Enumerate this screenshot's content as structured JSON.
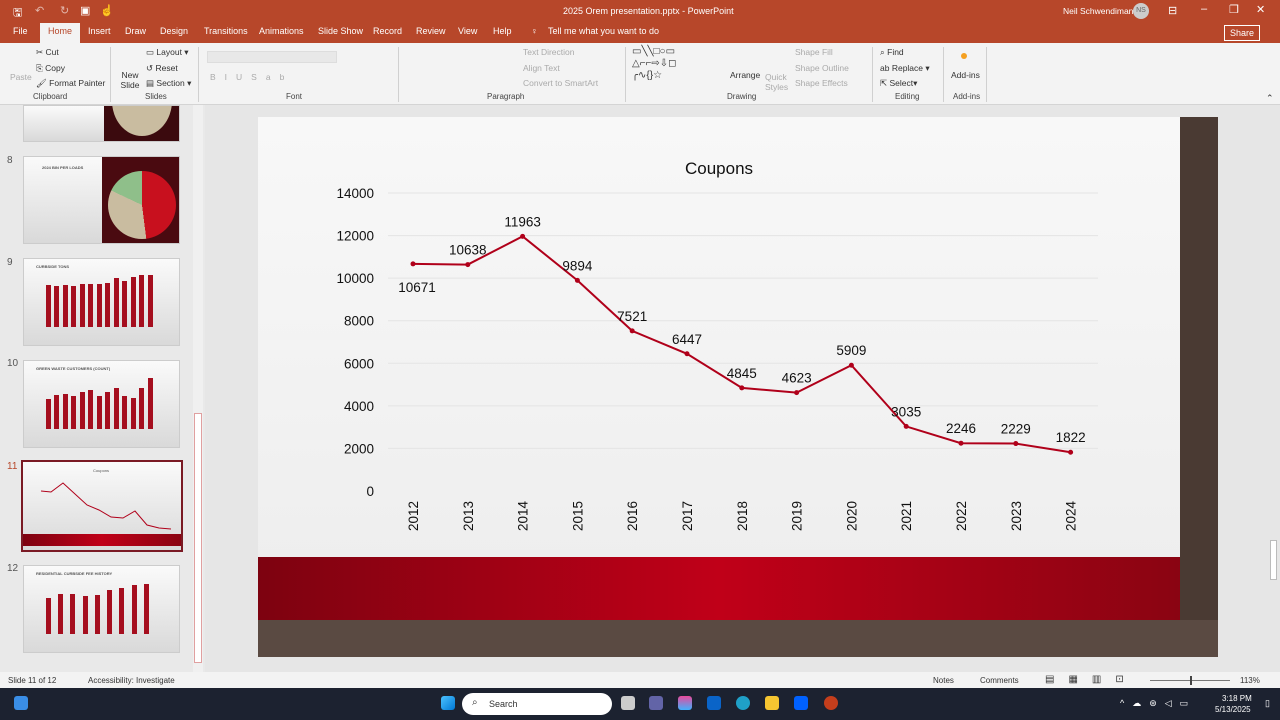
{
  "window": {
    "title": "2025 Orem presentation.pptx - PowerPoint",
    "user": "Neil Schwendiman",
    "initials": "NS",
    "share": "Share"
  },
  "tabs": [
    "File",
    "Home",
    "Insert",
    "Draw",
    "Design",
    "Transitions",
    "Animations",
    "Slide Show",
    "Record",
    "Review",
    "View",
    "Help"
  ],
  "tell_me": "Tell me what you want to do",
  "ribbon": {
    "clipboard": {
      "paste": "Paste",
      "cut": "Cut",
      "copy": "Copy",
      "format_painter": "Format Painter",
      "label": "Clipboard"
    },
    "slides": {
      "new_slide": "New Slide",
      "layout": "Layout",
      "reset": "Reset",
      "section": "Section",
      "label": "Slides"
    },
    "font": {
      "label": "Font"
    },
    "paragraph": {
      "text_direction": "Text Direction",
      "align_text": "Align Text",
      "convert": "Convert to SmartArt",
      "label": "Paragraph"
    },
    "drawing": {
      "arrange": "Arrange",
      "quick_styles": "Quick Styles",
      "shape_fill": "Shape Fill",
      "shape_outline": "Shape Outline",
      "shape_effects": "Shape Effects",
      "label": "Drawing"
    },
    "editing": {
      "find": "Find",
      "replace": "Replace",
      "select": "Select",
      "label": "Editing"
    },
    "addins": {
      "addins": "Add-ins",
      "label": "Add-ins"
    }
  },
  "thumbnails": [
    {
      "num": "8",
      "title": "2024 BIN PER LOADS"
    },
    {
      "num": "9",
      "title": "CURBSIDE TONS"
    },
    {
      "num": "10",
      "title": "GREEN WASTE CUSTOMERS (COUNT)"
    },
    {
      "num": "11",
      "title": "Coupons"
    },
    {
      "num": "12",
      "title": "RESIDENTIAL CURBSIDE FEE HISTORY"
    }
  ],
  "chart_data": {
    "type": "line",
    "title": "Coupons",
    "categories": [
      "2012",
      "2013",
      "2014",
      "2015",
      "2016",
      "2017",
      "2018",
      "2019",
      "2020",
      "2021",
      "2022",
      "2023",
      "2024"
    ],
    "values": [
      10671,
      10638,
      11963,
      9894,
      7521,
      6447,
      4845,
      4623,
      5909,
      3035,
      2246,
      2229,
      1822
    ],
    "yticks": [
      0,
      2000,
      4000,
      6000,
      8000,
      10000,
      12000,
      14000
    ],
    "ylim": [
      0,
      14000
    ],
    "color": "#b0001a"
  },
  "status": {
    "slide": "Slide 11 of 12",
    "accessibility": "Accessibility: Investigate",
    "notes": "Notes",
    "comments": "Comments",
    "zoom": "113%"
  },
  "taskbar": {
    "search": "Search",
    "time": "3:18 PM",
    "date": "5/13/2025"
  }
}
